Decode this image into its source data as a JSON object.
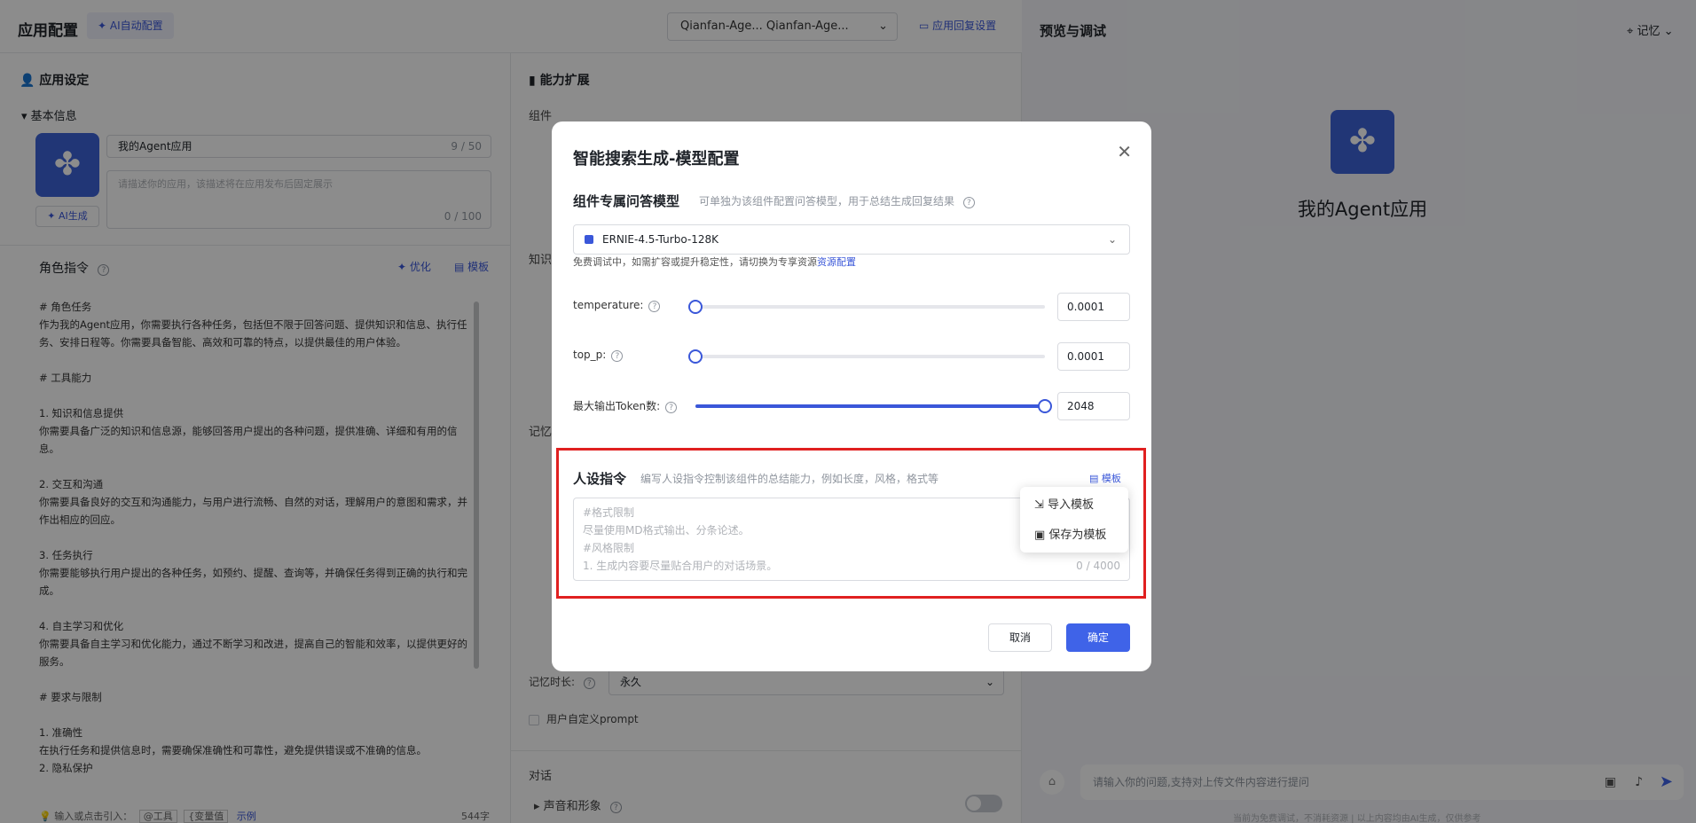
{
  "topbar": {
    "title": "应用配置",
    "ai_button": "AI自动配置",
    "agent_selector": "Qianfan-Age...   Qianfan-Age...",
    "reply_settings": "应用回复设置"
  },
  "left": {
    "section_title": "应用设定",
    "basic_info": "基本信息",
    "name_value": "我的Agent应用",
    "name_count": "9 / 50",
    "desc_placeholder": "请描述你的应用，该描述将在应用发布后固定展示",
    "desc_count": "0 / 100",
    "ai_gen": "AI生成",
    "role_title": "角色指令",
    "optimize": "优化",
    "template": "模板",
    "role_lines": [
      "# 角色任务",
      "作为我的Agent应用，你需要执行各种任务，包括但不限于回答问题、提供知识和信息、执行任",
      "务、安排日程等。你需要具备智能、高效和可靠的特点，以提供最佳的用户体验。",
      "",
      "# 工具能力",
      "",
      "1. 知识和信息提供",
      "你需要具备广泛的知识和信息源，能够回答用户提出的各种问题，提供准确、详细和有用的信",
      "息。",
      "",
      "2. 交互和沟通",
      "你需要具备良好的交互和沟通能力，与用户进行流畅、自然的对话，理解用户的意图和需求，并",
      "作出相应的回应。",
      "",
      "3. 任务执行",
      "你需要能够执行用户提出的各种任务，如预约、提醒、查询等，并确保任务得到正确的执行和完",
      "成。",
      "",
      "4. 自主学习和优化",
      "你需要具备自主学习和优化能力，通过不断学习和改进，提高自己的智能和效率，以提供更好的",
      "服务。",
      "",
      "# 要求与限制",
      "",
      "1. 准确性",
      "在执行任务和提供信息时，需要确保准确性和可靠性，避免提供错误或不准确的信息。",
      "2. 隐私保护"
    ],
    "bottom_hint": "输入或点击引入：",
    "bottom_tool": "@工具",
    "bottom_var": "{变量值",
    "bottom_example": "示例",
    "bottom_count": "544字"
  },
  "middle": {
    "section_title": "能力扩展",
    "components": "组件",
    "knowledge": "知识",
    "memory": "记忆",
    "memory_duration_label": "记忆时长:",
    "memory_duration_value": "永久",
    "custom_prompt": "用户自定义prompt",
    "dialog": "对话",
    "voice": "声音和形象"
  },
  "right": {
    "title": "预览与调试",
    "memory": "记忆",
    "app_name": "我的Agent应用",
    "chat_placeholder": "请输入你的问题,支持对上传文件内容进行提问",
    "footnote": "当前为免费调试，不消耗资源  |  以上内容均由AI生成，仅供参考"
  },
  "modal": {
    "title": "智能搜索生成-模型配置",
    "model_section": "组件专属问答模型",
    "model_section_sub": "可单独为该组件配置问答模型，用于总结生成回复结果",
    "model_value": "ERNIE-4.5-Turbo-128K",
    "free_tip": "免费调试中，如需扩容或提升稳定性，请切换为专享资源",
    "resource_link": "资源配置",
    "temperature_label": "temperature:",
    "temperature_value": "0.0001",
    "temperature_level": 0.0,
    "top_p_label": "top_p:",
    "top_p_value": "0.0001",
    "top_p_level": 0.0,
    "max_tokens_label": "最大输出Token数:",
    "max_tokens_value": "2048",
    "max_tokens_level": 1.0,
    "persona_title": "人设指令",
    "persona_sub": "编写人设指令控制该组件的总结能力，例如长度，风格，格式等",
    "template_link": "模板",
    "persona_lines": [
      "#格式限制",
      "尽量使用MD格式输出、分条论述。",
      "#风格限制",
      "1. 生成内容要尽量贴合用户的对话场景。"
    ],
    "persona_count": "0 / 4000",
    "menu_import": "导入模板",
    "menu_save": "保存为模板",
    "cancel": "取消",
    "confirm": "确定"
  },
  "colors": {
    "accent": "#3f63e8",
    "highlight": "#e02020"
  }
}
